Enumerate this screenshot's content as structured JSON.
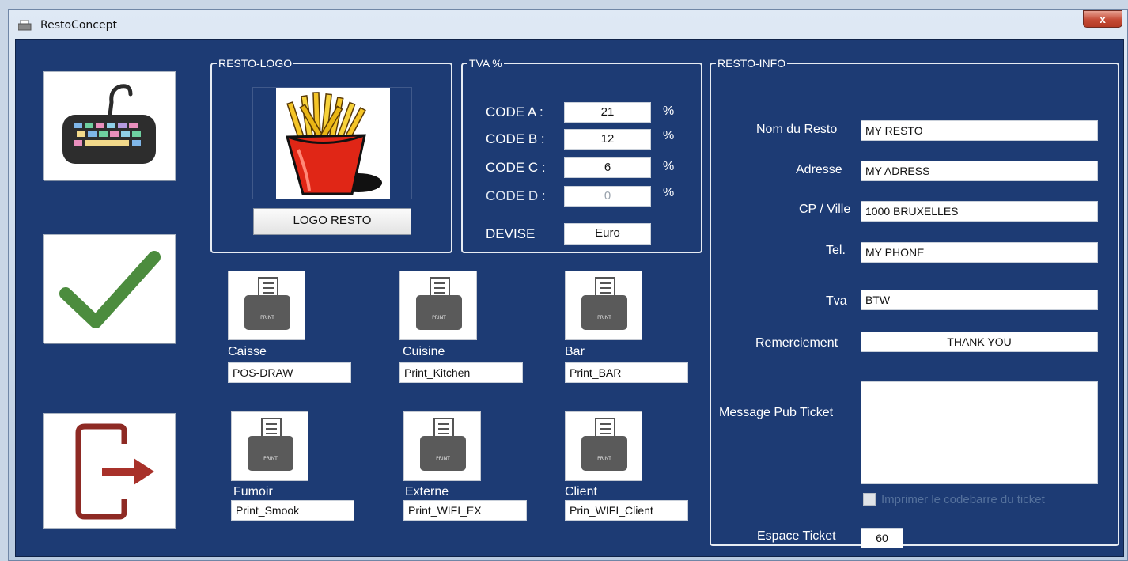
{
  "window": {
    "title": "RestoConcept",
    "close_label": "x"
  },
  "sidebar": {
    "keyboard_icon": "keyboard-icon",
    "confirm_icon": "checkmark-icon",
    "exit_icon": "exit-door-icon"
  },
  "logo_group": {
    "legend": "RESTO-LOGO",
    "button_label": "LOGO RESTO",
    "image": "french-fries-logo"
  },
  "tva_group": {
    "legend": "TVA %",
    "rows": [
      {
        "label": "CODE A :",
        "value": "21",
        "unit": "%"
      },
      {
        "label": "CODE B :",
        "value": "12",
        "unit": "%"
      },
      {
        "label": "CODE C :",
        "value": "6",
        "unit": "%"
      },
      {
        "label": "CODE D :",
        "value": "0",
        "unit": "%"
      }
    ],
    "devise_label": "DEVISE",
    "devise_value": "Euro"
  },
  "printers": [
    {
      "label": "Caisse",
      "value": "POS-DRAW",
      "icon_text": "PRINT"
    },
    {
      "label": "Cuisine",
      "value": "Print_Kitchen",
      "icon_text": "PRINT"
    },
    {
      "label": "Bar",
      "value": "Print_BAR",
      "icon_text": "PRINT"
    },
    {
      "label": "Fumoir",
      "value": "Print_Smook",
      "icon_text": "PRINT"
    },
    {
      "label": "Externe",
      "value": "Print_WIFI_EX",
      "icon_text": "PRINT"
    },
    {
      "label": "Client",
      "value": "Prin_WIFI_Client",
      "icon_text": "PRINT"
    }
  ],
  "info_group": {
    "legend": "RESTO-INFO",
    "nom_label": "Nom du Resto",
    "nom_value": "MY RESTO",
    "adresse_label": "Adresse",
    "adresse_value": "MY ADRESS",
    "cp_label": "CP / Ville",
    "cp_value": "1000 BRUXELLES",
    "tel_label": "Tel.",
    "tel_value": "MY PHONE",
    "tva_label": "Tva",
    "tva_value": "BTW",
    "remerciement_label": "Remerciement",
    "remerciement_value": "THANK YOU",
    "message_label": "Message Pub Ticket",
    "message_value": "",
    "barcode_label": "Imprimer le codebarre du ticket",
    "espace_label": "Espace Ticket",
    "espace_value": "60"
  }
}
